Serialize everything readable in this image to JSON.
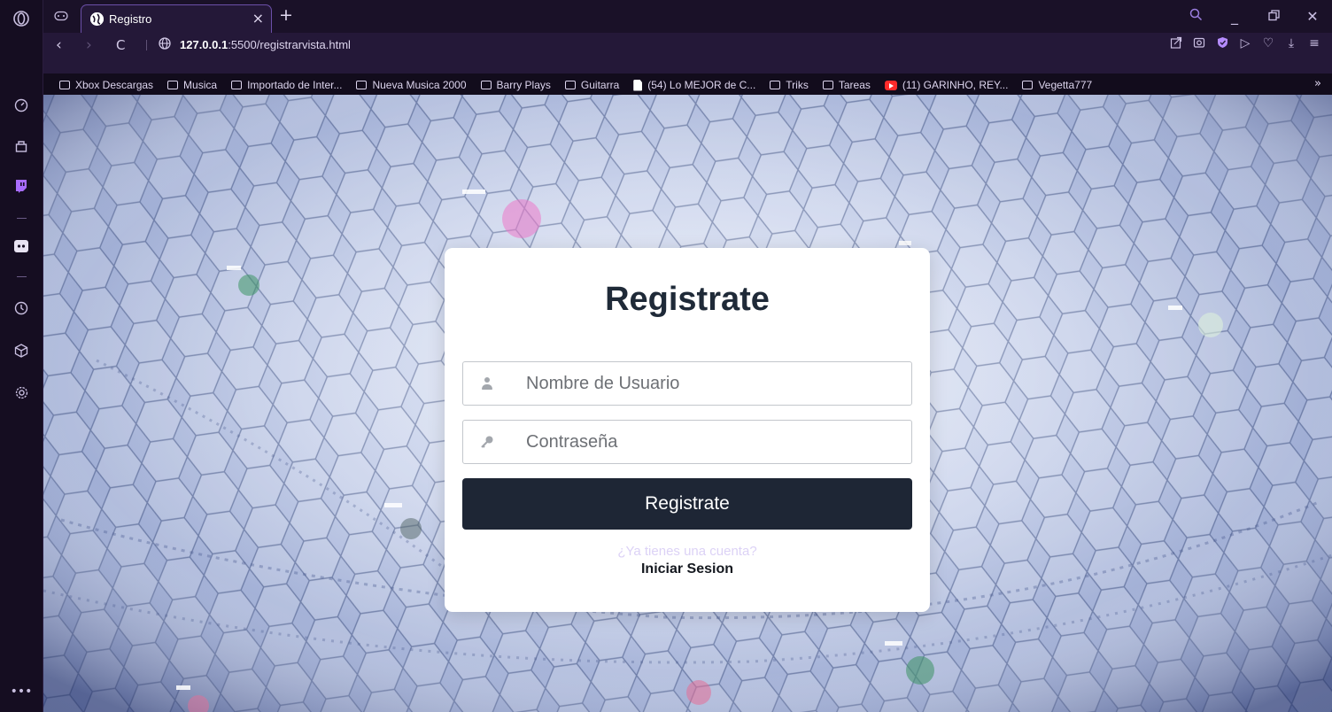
{
  "browser": {
    "tab_title": "Registro",
    "url_host": "127.0.0.1",
    "url_rest": ":5500/registrarvista.html",
    "bookmarks": [
      {
        "label": "Xbox Descargas",
        "icon": "folder"
      },
      {
        "label": "Musica",
        "icon": "folder"
      },
      {
        "label": "Importado de Inter...",
        "icon": "folder"
      },
      {
        "label": "Nueva Musica 2000",
        "icon": "folder"
      },
      {
        "label": "Barry Plays",
        "icon": "folder"
      },
      {
        "label": "Guitarra",
        "icon": "folder"
      },
      {
        "label": "(54) Lo MEJOR de C...",
        "icon": "document"
      },
      {
        "label": "Triks",
        "icon": "folder"
      },
      {
        "label": "Tareas",
        "icon": "folder"
      },
      {
        "label": "(11) GARINHO, REY...",
        "icon": "youtube"
      },
      {
        "label": "Vegetta777",
        "icon": "folder"
      }
    ],
    "accent_color": "#6b4fa8",
    "sidebar_icons": [
      "opera-logo-icon",
      "speed-dial-icon",
      "shopping-icon",
      "twitch-icon",
      "discord-icon",
      "history-icon",
      "extensions-icon",
      "settings-icon",
      "more-icon"
    ]
  },
  "form": {
    "title": "Registrate",
    "username_placeholder": "Nombre de Usuario",
    "password_placeholder": "Contraseña",
    "submit_label": "Registrate",
    "account_hint": "¿Ya tienes una cuenta?",
    "login_link": "Iniciar Sesion"
  }
}
